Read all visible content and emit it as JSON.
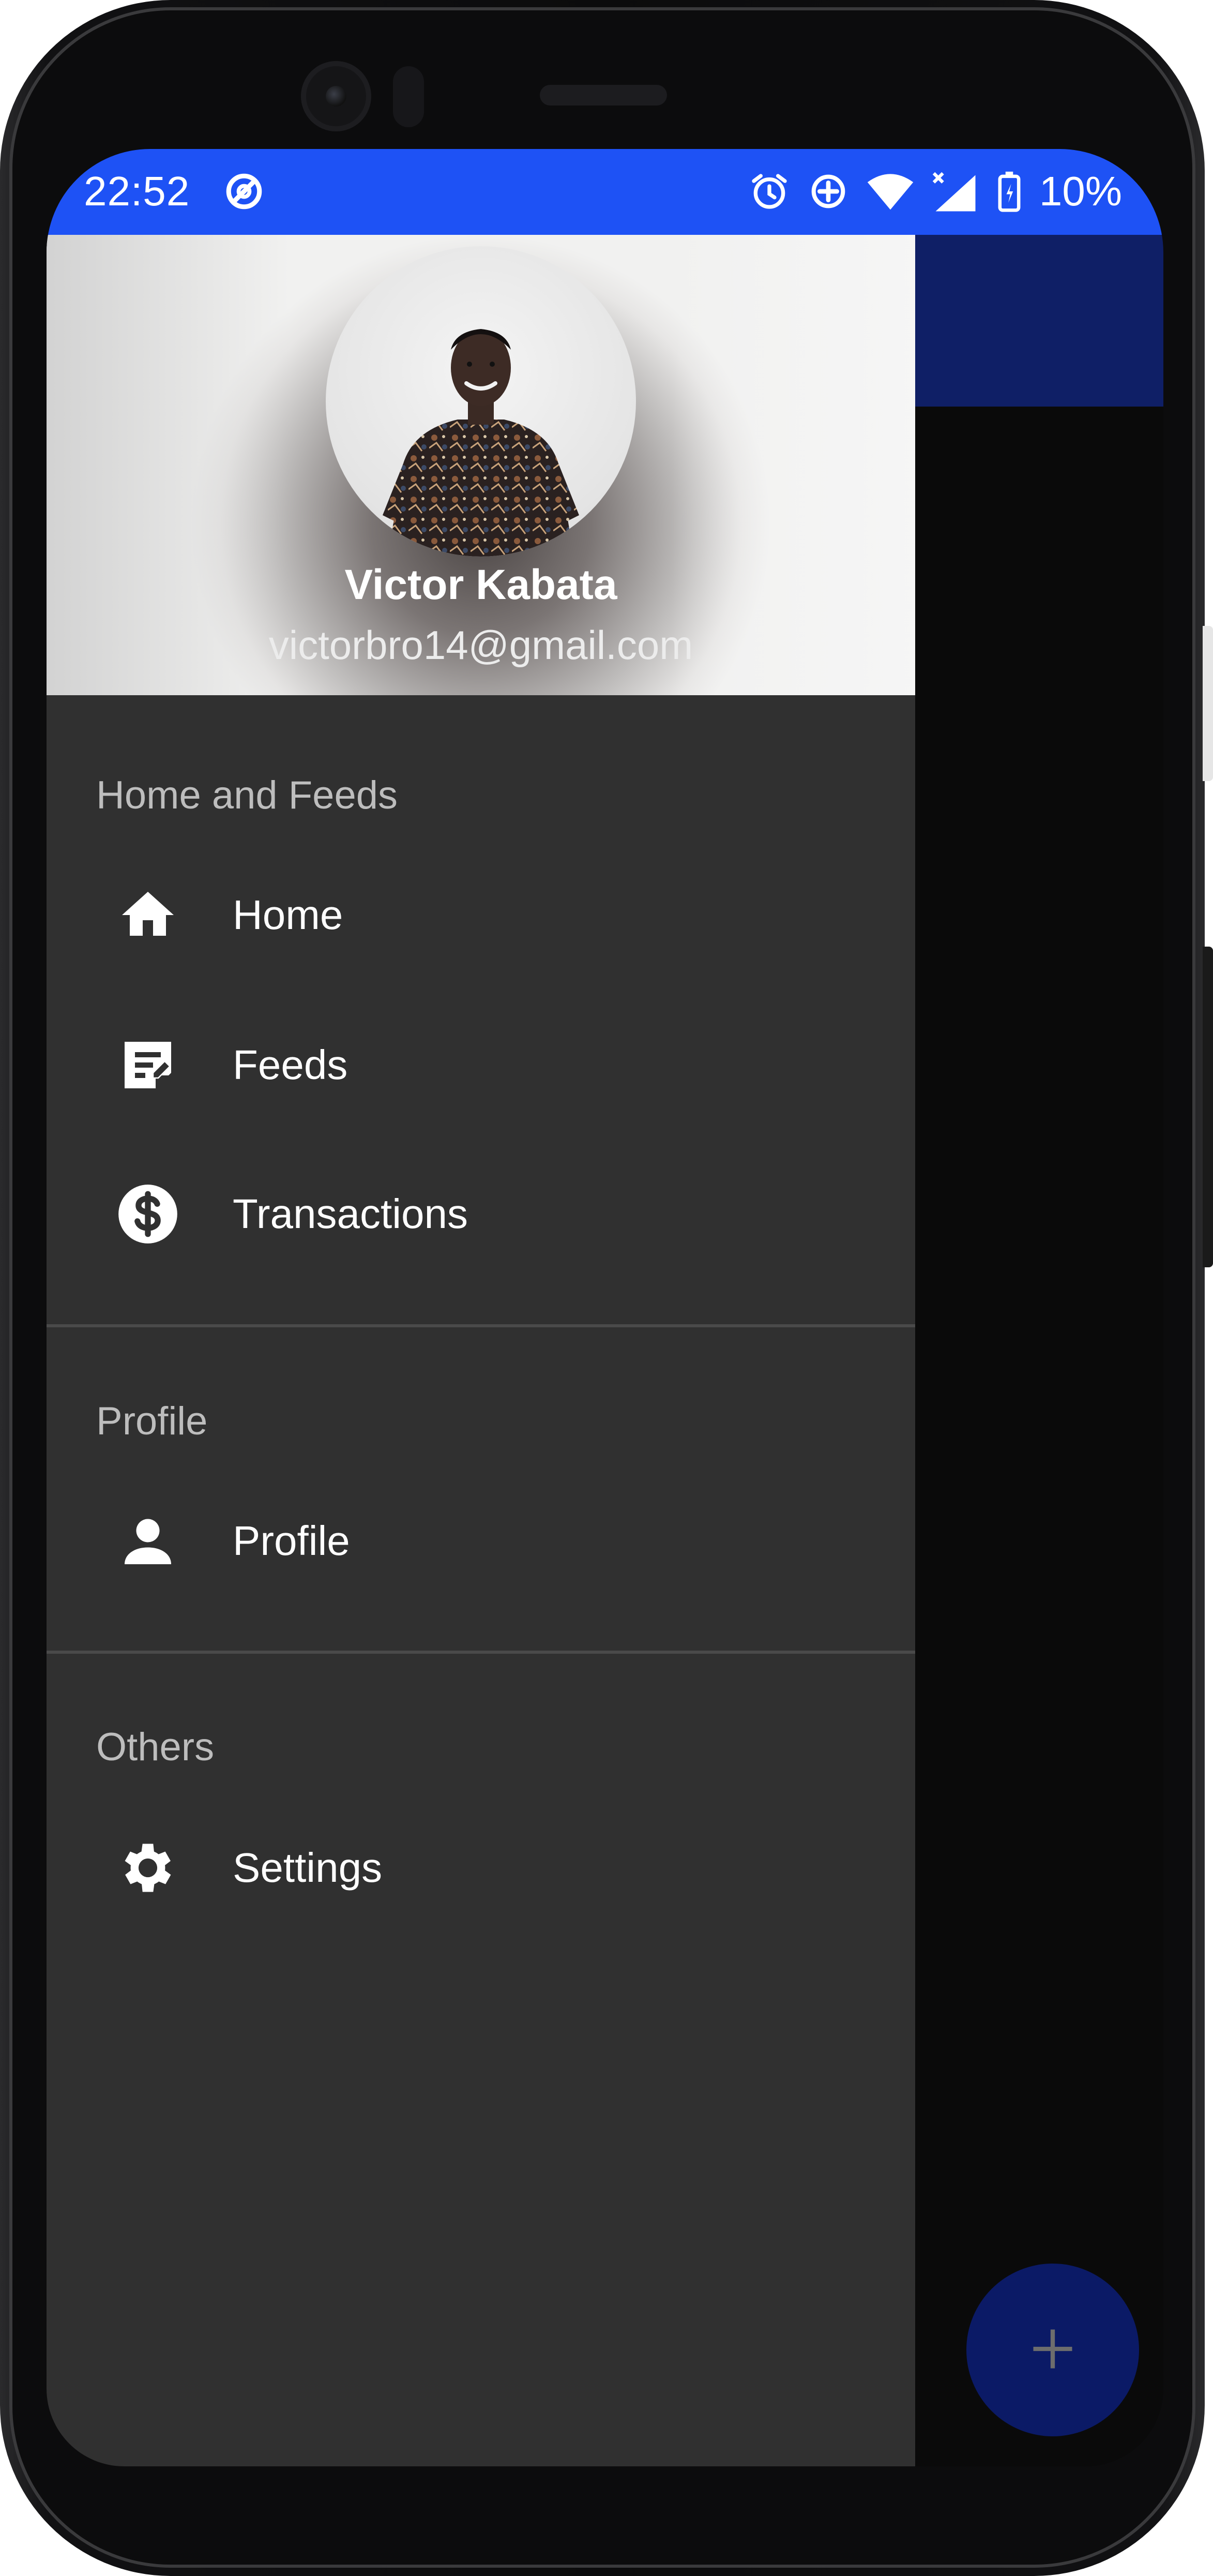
{
  "status_bar": {
    "time": "22:52",
    "battery_percent": "10%",
    "color": "#1e52f5"
  },
  "drawer": {
    "header": {
      "name": "Victor Kabata",
      "email": "victorbro14@gmail.com"
    },
    "sections": [
      {
        "title": "Home and Feeds",
        "items": [
          {
            "label": "Home",
            "icon": "home-icon"
          },
          {
            "label": "Feeds",
            "icon": "feeds-icon"
          },
          {
            "label": "Transactions",
            "icon": "dollar-icon"
          }
        ]
      },
      {
        "title": "Profile",
        "items": [
          {
            "label": "Profile",
            "icon": "person-icon"
          }
        ]
      },
      {
        "title": "Others",
        "items": [
          {
            "label": "Settings",
            "icon": "gear-icon"
          }
        ]
      }
    ],
    "background_color": "#303030"
  },
  "app": {
    "toolbar_color": "#0f1f66",
    "fab_icon": "plus-icon"
  }
}
